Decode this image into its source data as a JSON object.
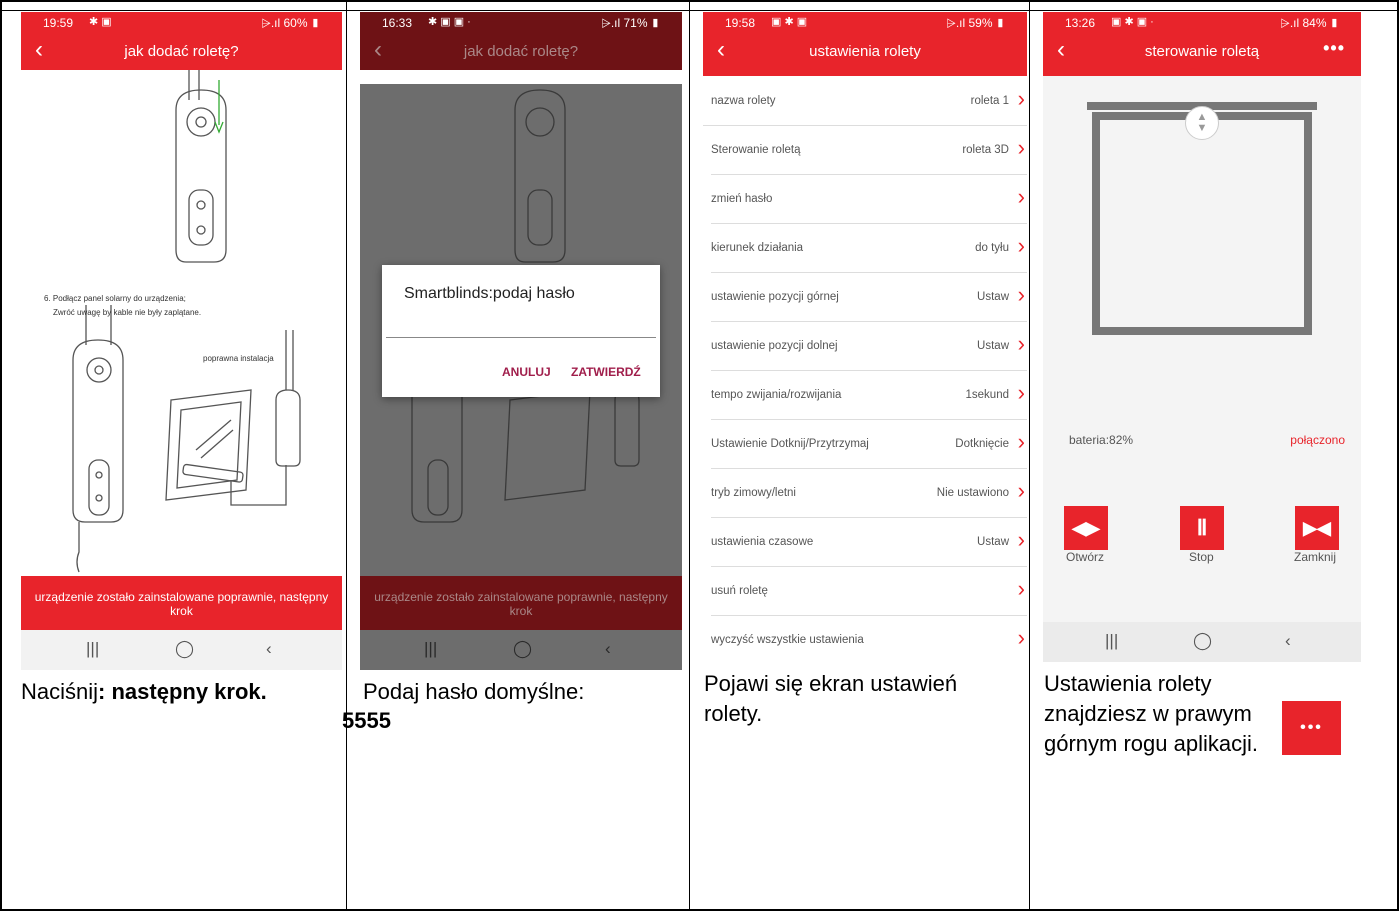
{
  "colors": {
    "accent": "#e8242b",
    "dialog_button": "#a01e4b"
  },
  "panel1": {
    "status_time": "19:59",
    "status_battery": "60%",
    "title": "jak dodać roletę?",
    "instruction_line1": "6. Podłącz panel solarny do urządzenia;",
    "instruction_line2": "Zwróć uwagę by kable nie były zaplątane.",
    "install_label": "poprawna instalacja",
    "button": "urządzenie zostało zainstalowane poprawnie, następny krok",
    "caption_prefix": "Naciśnij",
    "caption_bold": ": następny krok."
  },
  "panel2": {
    "status_time": "16:33",
    "status_battery": "71%",
    "title": "jak dodać roletę?",
    "dialog_title": "Smartblinds:podaj hasło",
    "dialog_cancel": "ANULUJ",
    "dialog_confirm": "ZATWIERDŹ",
    "button": "urządzenie zostało zainstalowane poprawnie, następny krok",
    "caption": "Podaj hasło domyślne:",
    "caption_password": "5555"
  },
  "panel3": {
    "status_time": "19:58",
    "status_battery": "59%",
    "title": "ustawienia rolety",
    "rows": [
      {
        "label": "nazwa rolety",
        "value": "roleta 1"
      },
      {
        "label": "Sterowanie roletą",
        "value": "roleta 3D"
      },
      {
        "label": "zmień hasło",
        "value": ""
      },
      {
        "label": "kierunek działania",
        "value": "do tyłu"
      },
      {
        "label": "ustawienie pozycji górnej",
        "value": "Ustaw"
      },
      {
        "label": "ustawienie pozycji dolnej",
        "value": "Ustaw"
      },
      {
        "label": "tempo zwijania/rozwijania",
        "value": "1sekund"
      },
      {
        "label": "Ustawienie Dotknij/Przytrzymaj",
        "value": "Dotknięcie"
      },
      {
        "label": "tryb zimowy/letni",
        "value": "Nie ustawiono"
      },
      {
        "label": "ustawienia czasowe",
        "value": "Ustaw"
      },
      {
        "label": "usuń roletę",
        "value": ""
      },
      {
        "label": "wyczyść wszystkie ustawienia",
        "value": ""
      }
    ],
    "caption": "Pojawi się ekran ustawień rolety."
  },
  "panel4": {
    "status_time": "13:26",
    "status_battery": "84%",
    "title": "sterowanie roletą",
    "battery": "bateria:82%",
    "connection": "połączono",
    "btn_open": "Otwórz",
    "btn_stop": "Stop",
    "btn_close": "Zamknij",
    "caption": "Ustawienia rolety znajdziesz w prawym górnym rogu aplikacji."
  }
}
